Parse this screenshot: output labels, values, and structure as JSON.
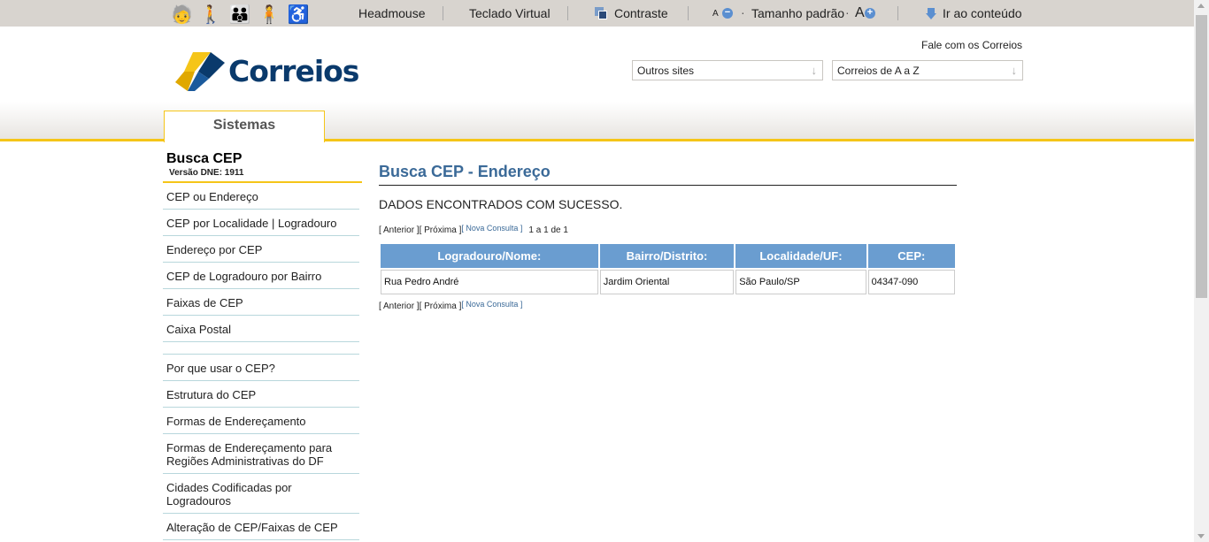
{
  "topbar": {
    "headmouse": "Headmouse",
    "teclado": "Teclado Virtual",
    "contraste": "Contraste",
    "small_a": "A",
    "tamanho": "Tamanho padrão",
    "big_a": "A",
    "ir_conteudo": "Ir ao conteúdo",
    "accessibility_icons": [
      "elderly-person-icon",
      "walking-person-icon",
      "person-with-child-icon",
      "standing-person-icon",
      "wheelchair-icon"
    ]
  },
  "header": {
    "logo_text": "Correios",
    "fale": "Fale com os Correios",
    "select_outros": "Outros sites",
    "select_correios": "Correios de A a Z",
    "tab": "Sistemas"
  },
  "sidebar": {
    "title": "Busca CEP",
    "version": "Versão DNE: 1911",
    "items_top": [
      {
        "label": "CEP ou Endereço"
      },
      {
        "label": "CEP por Localidade | Logradouro"
      },
      {
        "label": "Endereço por CEP"
      },
      {
        "label": "CEP de Logradouro por Bairro"
      },
      {
        "label": "Faixas de CEP"
      },
      {
        "label": "Caixa Postal"
      }
    ],
    "items_bottom": [
      {
        "label": "Por que usar o CEP?"
      },
      {
        "label": "Estrutura do CEP"
      },
      {
        "label": "Formas de Endereçamento"
      },
      {
        "label": "Formas de Endereçamento para Regiões Administrativas do DF"
      },
      {
        "label": "Cidades Codificadas por Logradouros"
      },
      {
        "label": "Alteração de CEP/Faixas de CEP"
      }
    ]
  },
  "main": {
    "title": "Busca CEP - Endereço",
    "message": "DADOS ENCONTRADOS COM SUCESSO.",
    "pager": {
      "anterior": "[ Anterior ]",
      "proxima": "[ Próxima ]",
      "nova": "[ Nova Consulta ]",
      "count": "1 a 1 de 1"
    },
    "table": {
      "headers": [
        "Logradouro/Nome:",
        "Bairro/Distrito:",
        "Localidade/UF:",
        "CEP:"
      ],
      "rows": [
        [
          "Rua Pedro André",
          "Jardim Oriental",
          "São Paulo/SP",
          "04347-090"
        ]
      ]
    }
  },
  "colors": {
    "brand_yellow": "#f5c518",
    "brand_blue": "#0a3a6c",
    "title_blue": "#3b6a98",
    "table_header": "#6a9dd0"
  }
}
